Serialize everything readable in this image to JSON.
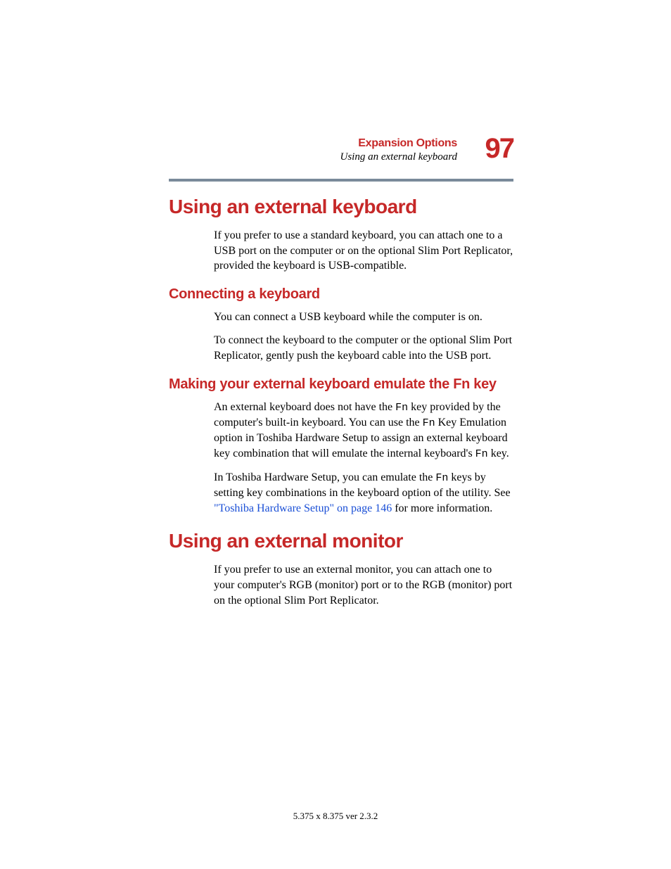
{
  "header": {
    "chapter": "Expansion Options",
    "section": "Using an external keyboard",
    "page_number": "97"
  },
  "sections": {
    "s1": {
      "title": "Using an external keyboard",
      "p1": "If you prefer to use a standard keyboard, you can attach one to a USB port on the computer or on the optional Slim Port Replicator, provided the keyboard is USB-compatible."
    },
    "s1a": {
      "title": "Connecting a keyboard",
      "p1": "You can connect a USB keyboard while the computer is on.",
      "p2": "To connect the keyboard to the computer or the optional Slim Port Replicator, gently push the keyboard cable into the USB port."
    },
    "s1b": {
      "title": "Making your external keyboard emulate the Fn key",
      "p1a": "An external keyboard does not have the ",
      "p1_fn1": "Fn",
      "p1b": " key provided by the computer's built-in keyboard. You can use the ",
      "p1_fn2": "Fn",
      "p1c": " Key Emulation option in Toshiba Hardware Setup to assign an external keyboard key combination that will emulate the internal keyboard's ",
      "p1_fn3": "Fn",
      "p1d": " key.",
      "p2a": "In Toshiba Hardware Setup, you can emulate the ",
      "p2_fn": "Fn",
      "p2b": " keys by setting key combinations in the keyboard option of the utility. See ",
      "p2_xref": "\"Toshiba Hardware Setup\" on page 146",
      "p2c": " for more information."
    },
    "s2": {
      "title": "Using an external monitor",
      "p1": "If you prefer to use an external monitor, you can attach one to your computer's RGB (monitor) port or to the RGB (monitor) port on the optional Slim Port Replicator."
    }
  },
  "footer": "5.375 x 8.375 ver 2.3.2"
}
